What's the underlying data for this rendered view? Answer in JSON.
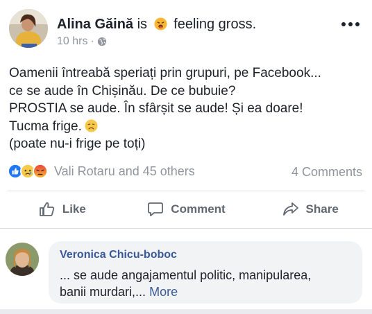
{
  "post": {
    "author": "Alina Găină",
    "is_text": "is",
    "feeling": "feeling gross.",
    "timestamp": "10 hrs",
    "meta_sep": "·",
    "text_lines": [
      "Oamenii întreabă speriați prin grupuri, pe Facebook...",
      "ce se aude în Chișinău. De ce bubuie?",
      "PROSTIA se aude. În sfârșit se aude! Și ea doare!",
      "Tucma frige.",
      "(poate nu-i frige pe toți)"
    ],
    "icons": {
      "feeling": "sick-face-emoji-icon",
      "inline": "sad-face-emoji-icon",
      "audience": "globe-icon",
      "menu": "more-options-icon"
    }
  },
  "reactions": {
    "names": "Vali Rotaru and 45 others",
    "comments_count": "4 Comments",
    "icons": [
      "like-reaction-icon",
      "sad-reaction-icon",
      "angry-reaction-icon"
    ]
  },
  "actions": {
    "like": "Like",
    "comment": "Comment",
    "share": "Share"
  },
  "comment": {
    "author": "Veronica Chicu-boboc",
    "text_line1": "... se aude angajamentul politic, manipularea,",
    "text_line2": "banii murdari,...",
    "more": "More"
  },
  "colors": {
    "text": "#1d2129",
    "secondary": "#90949c",
    "action": "#606770",
    "link": "#385898",
    "like_blue": "#2078f4",
    "bubble": "#f2f3f5"
  }
}
